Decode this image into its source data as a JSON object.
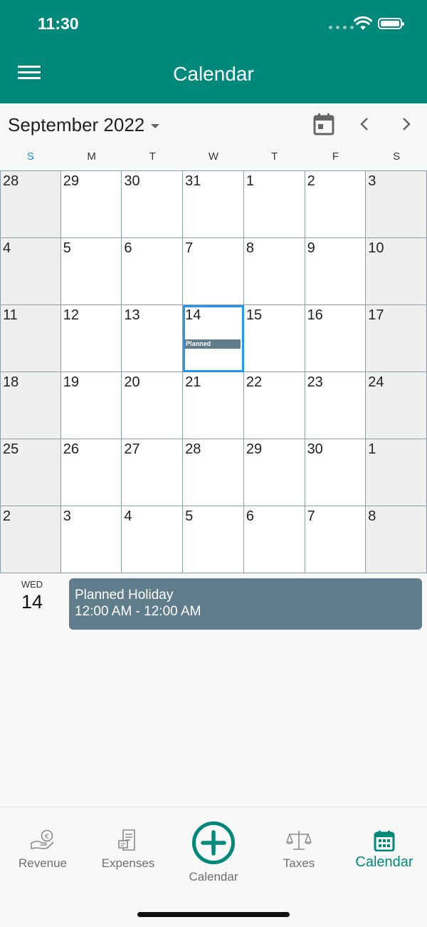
{
  "status_bar": {
    "time": "11:30"
  },
  "header": {
    "title": "Calendar"
  },
  "calendar": {
    "month_label": "September 2022",
    "weekdays": [
      "S",
      "M",
      "T",
      "W",
      "T",
      "F",
      "S"
    ],
    "days": [
      "28",
      "29",
      "30",
      "31",
      "1",
      "2",
      "3",
      "4",
      "5",
      "6",
      "7",
      "8",
      "9",
      "10",
      "11",
      "12",
      "13",
      "14",
      "15",
      "16",
      "17",
      "18",
      "19",
      "20",
      "21",
      "22",
      "23",
      "24",
      "25",
      "26",
      "27",
      "28",
      "29",
      "30",
      "1",
      "2",
      "3",
      "4",
      "5",
      "6",
      "7",
      "8"
    ],
    "selected_day": "14",
    "event_chip_label": "Planned"
  },
  "agenda": {
    "weekday": "WED",
    "day": "14",
    "event": {
      "title": "Planned Holiday",
      "time": "12:00 AM - 12:00 AM"
    }
  },
  "bottom_nav": {
    "revenue": "Revenue",
    "expenses": "Expenses",
    "add": "Calendar",
    "taxes": "Taxes",
    "calendar": "Calendar"
  },
  "colors": {
    "primary": "#00897b",
    "event": "#607d8b",
    "selected_border": "#2196f3",
    "sunday_label": "#1e88e5"
  }
}
